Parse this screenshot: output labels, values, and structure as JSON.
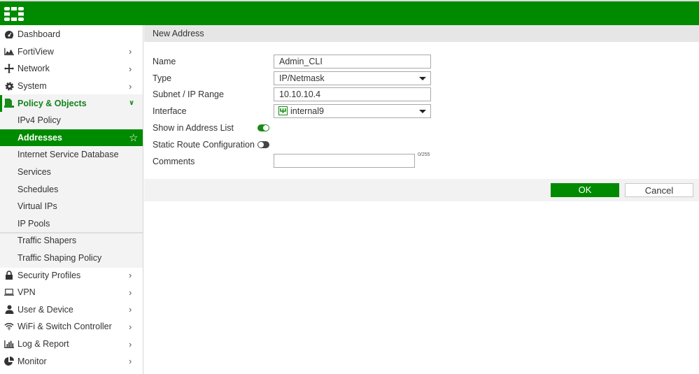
{
  "brand_color": "#008a00",
  "sidebar": {
    "items": [
      {
        "label": "Dashboard",
        "icon": "dashboard-icon",
        "chevron": false
      },
      {
        "label": "FortiView",
        "icon": "fortiview-icon",
        "chevron": true
      },
      {
        "label": "Network",
        "icon": "network-icon",
        "chevron": true
      },
      {
        "label": "System",
        "icon": "gear-icon",
        "chevron": true
      },
      {
        "label": "Policy & Objects",
        "icon": "policy-icon",
        "chevron": "down"
      },
      {
        "label": "IPv4 Policy",
        "sub": true
      },
      {
        "label": "Addresses",
        "sub": true,
        "active": true
      },
      {
        "label": "Internet Service Database",
        "sub": true
      },
      {
        "label": "Services",
        "sub": true
      },
      {
        "label": "Schedules",
        "sub": true
      },
      {
        "label": "Virtual IPs",
        "sub": true
      },
      {
        "label": "IP Pools",
        "sub": true
      },
      {
        "label": "Traffic Shapers",
        "sub": true
      },
      {
        "label": "Traffic Shaping Policy",
        "sub": true
      },
      {
        "label": "Security Profiles",
        "icon": "lock-icon",
        "chevron": true
      },
      {
        "label": "VPN",
        "icon": "laptop-icon",
        "chevron": true
      },
      {
        "label": "User & Device",
        "icon": "user-icon",
        "chevron": true
      },
      {
        "label": "WiFi & Switch Controller",
        "icon": "wifi-icon",
        "chevron": true
      },
      {
        "label": "Log & Report",
        "icon": "bar-chart-icon",
        "chevron": true
      },
      {
        "label": "Monitor",
        "icon": "pie-chart-icon",
        "chevron": true
      }
    ]
  },
  "page": {
    "title": "New Address"
  },
  "form": {
    "name_label": "Name",
    "name_value": "Admin_CLI",
    "type_label": "Type",
    "type_value": "IP/Netmask",
    "subnet_label": "Subnet / IP Range",
    "subnet_value": "10.10.10.4",
    "interface_label": "Interface",
    "interface_value": "internal9",
    "show_label": "Show in Address List",
    "show_on": true,
    "static_label": "Static Route Configuration",
    "static_on": false,
    "comments_label": "Comments",
    "comments_value": "",
    "comments_count": "0/255"
  },
  "footer": {
    "ok": "OK",
    "cancel": "Cancel"
  }
}
